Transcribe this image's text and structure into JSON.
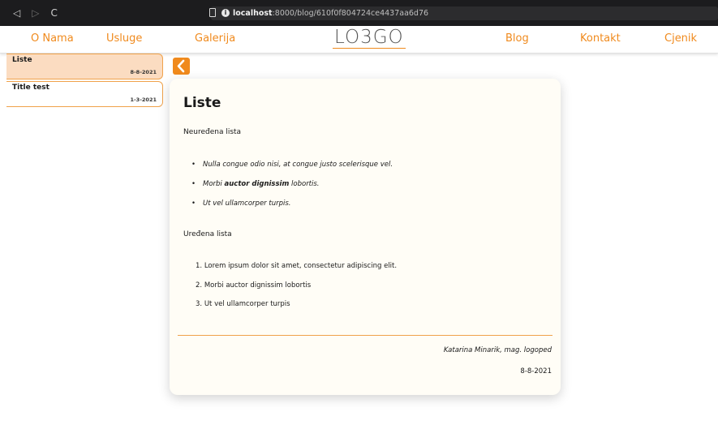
{
  "browser": {
    "url_host": "localhost",
    "url_path": ":8000/blog/610f0f804724ce4437aa6d76",
    "back_glyph": "◁",
    "forward_glyph": "▷",
    "reload_glyph": "C"
  },
  "header": {
    "logo": "LO3GO",
    "nav_left": [
      "O Nama",
      "Usluge",
      "Galerija"
    ],
    "nav_right": [
      "Blog",
      "Kontakt",
      "Cjenik"
    ],
    "accent_color": "#f08a1d"
  },
  "sidebar": {
    "items": [
      {
        "title": "Liste",
        "date": "8-8-2021",
        "active": true
      },
      {
        "title": "Title test",
        "date": "1-3-2021",
        "active": false
      }
    ]
  },
  "post": {
    "title": "Liste",
    "unordered_heading": "Neuređena lista",
    "unordered_items": [
      {
        "pre": "Nulla congue odio nisi, at congue justo scelerisque vel.",
        "bold": "",
        "post": ""
      },
      {
        "pre": "Morbi ",
        "bold": "auctor dignissim",
        "post": " lobortis."
      },
      {
        "pre": "Ut vel ullamcorper turpis.",
        "bold": "",
        "post": ""
      }
    ],
    "ordered_heading": "Uređena lista",
    "ordered_items": [
      {
        "num": "1.",
        "text": "Lorem ipsum dolor sit amet, consectetur adipiscing elit."
      },
      {
        "num": "2.",
        "text": "Morbi auctor dignissim lobortis"
      },
      {
        "num": "3.",
        "text": "Ut vel ullamcorper turpis"
      }
    ],
    "author": "Katarina Minarik, mag. logoped",
    "date": "8-8-2021"
  }
}
